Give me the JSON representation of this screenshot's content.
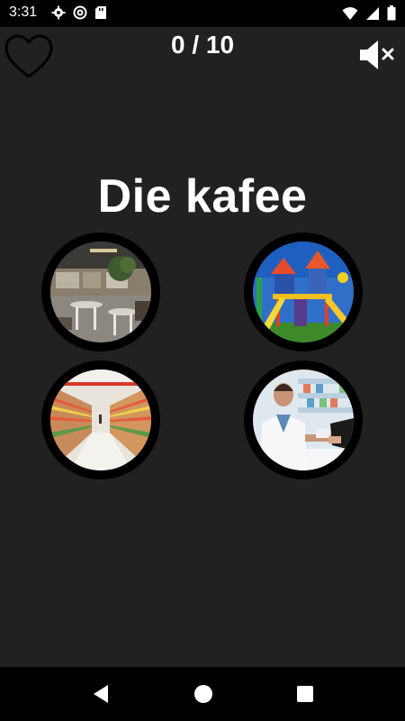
{
  "status_bar": {
    "time": "3:31",
    "left_icons": [
      "gear-icon",
      "at-sign-icon",
      "sd-card-icon"
    ],
    "right_icons": [
      "wifi-icon",
      "signal-icon",
      "battery-icon"
    ]
  },
  "header": {
    "score": "0 / 10",
    "heart_icon": "heart-outline-icon",
    "mute_icon": "speaker-muted-icon"
  },
  "quiz": {
    "word": "Die kafee",
    "options": [
      {
        "name": "cafe-image"
      },
      {
        "name": "playground-image"
      },
      {
        "name": "supermarket-image"
      },
      {
        "name": "pharmacy-image"
      }
    ]
  },
  "nav_bar": {
    "buttons": [
      "back-icon",
      "home-icon",
      "recents-icon"
    ]
  }
}
